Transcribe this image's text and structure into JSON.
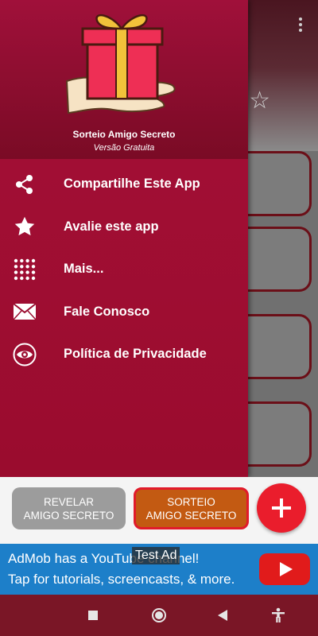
{
  "drawer": {
    "app_name": "Sorteio Amigo Secreto",
    "app_version": "Versão Gratuita",
    "items": [
      {
        "label": "Compartilhe Este App",
        "icon": "share-icon"
      },
      {
        "label": "Avalie este app",
        "icon": "star-icon"
      },
      {
        "label": "Mais...",
        "icon": "grid-icon"
      },
      {
        "label": "Fale Conosco",
        "icon": "mail-icon"
      },
      {
        "label": "Política de Privacidade",
        "icon": "eye-icon"
      }
    ]
  },
  "buttons": {
    "reveal_label": "REVELAR\nAMIGO SECRETO",
    "draw_label": "SORTEIO\nAMIGO SECRETO",
    "add_icon": "plus-icon"
  },
  "ad": {
    "line1": "AdMob has a YouTube channel!",
    "line2": "Tap for tutorials, screencasts, & more.",
    "tag": "Test Ad"
  },
  "colors": {
    "drawer": "#9b0d30",
    "draw_button": "#c35a12",
    "add_button": "#ea1d2c",
    "ad_background": "#1d7fc9"
  }
}
